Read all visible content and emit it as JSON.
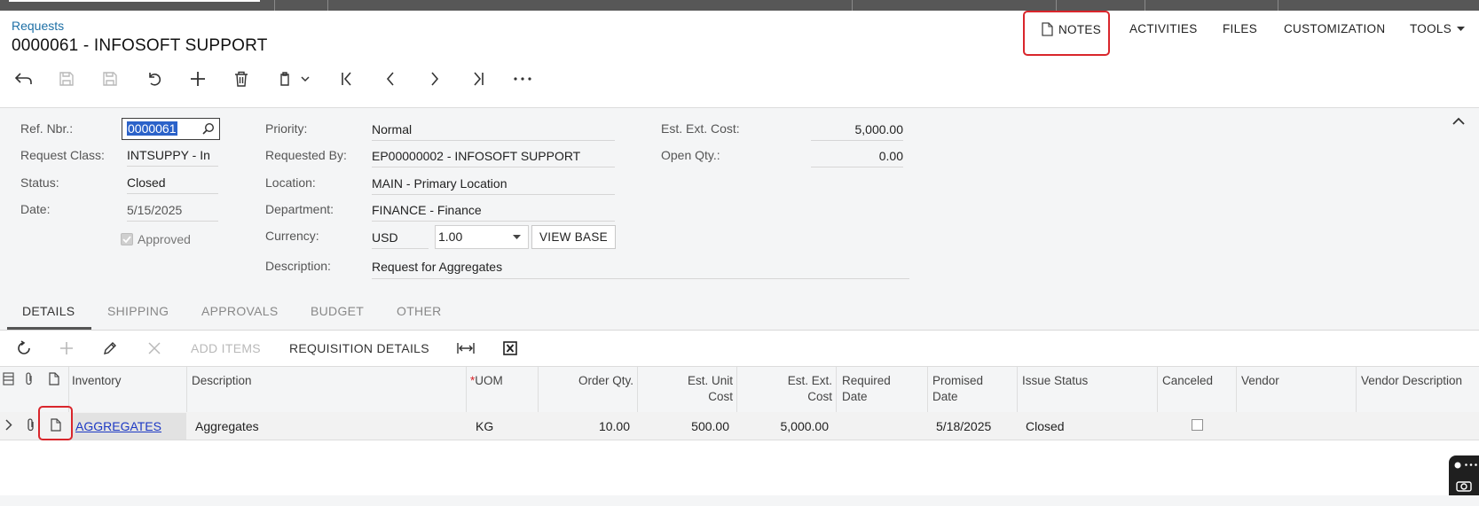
{
  "header": {
    "breadcrumb": "Requests",
    "title": "0000061 - INFOSOFT SUPPORT"
  },
  "top_actions": {
    "notes": "NOTES",
    "activities": "ACTIVITIES",
    "files": "FILES",
    "customization": "CUSTOMIZATION",
    "tools": "TOOLS"
  },
  "form": {
    "ref_nbr_label": "Ref. Nbr.:",
    "ref_nbr_value": "0000061",
    "request_class_label": "Request Class:",
    "request_class_value": "INTSUPPY - In",
    "status_label": "Status:",
    "status_value": "Closed",
    "date_label": "Date:",
    "date_value": "5/15/2025",
    "approved_label": "Approved",
    "priority_label": "Priority:",
    "priority_value": "Normal",
    "requested_by_label": "Requested By:",
    "requested_by_value": "EP00000002 - INFOSOFT SUPPORT",
    "location_label": "Location:",
    "location_value": "MAIN - Primary Location",
    "department_label": "Department:",
    "department_value": "FINANCE - Finance",
    "currency_label": "Currency:",
    "currency_value": "USD",
    "currency_rate": "1.00",
    "view_base": "VIEW BASE",
    "description_label": "Description:",
    "description_value": "Request for Aggregates",
    "est_ext_cost_label": "Est. Ext. Cost:",
    "est_ext_cost_value": "5,000.00",
    "open_qty_label": "Open Qty.:",
    "open_qty_value": "0.00"
  },
  "tabs": [
    "DETAILS",
    "SHIPPING",
    "APPROVALS",
    "BUDGET",
    "OTHER"
  ],
  "grid_toolbar": {
    "add_items": "ADD ITEMS",
    "requisition_details": "REQUISITION DETAILS"
  },
  "grid": {
    "columns": {
      "inventory": "Inventory",
      "description": "Description",
      "uom_required": "*",
      "uom": "UOM",
      "order_qty": "Order Qty.",
      "est_unit_cost_1": "Est. Unit",
      "est_unit_cost_2": "Cost",
      "est_ext_cost_1": "Est. Ext.",
      "est_ext_cost_2": "Cost",
      "required_date_1": "Required",
      "required_date_2": "Date",
      "promised_date_1": "Promised",
      "promised_date_2": "Date",
      "issue_status": "Issue Status",
      "canceled": "Canceled",
      "vendor": "Vendor",
      "vendor_description": "Vendor Description"
    },
    "row": {
      "inventory": "AGGREGATES",
      "description": "Aggregates",
      "uom": "KG",
      "order_qty": "10.00",
      "est_unit_cost": "500.00",
      "est_ext_cost": "5,000.00",
      "required_date": "",
      "promised_date": "5/18/2025",
      "issue_status": "Closed",
      "canceled": false,
      "vendor": "",
      "vendor_description": ""
    }
  },
  "colors": {
    "link": "#1d6fa5",
    "highlight": "#d9262c",
    "selection": "#2b62c9",
    "topbar": "#575757"
  }
}
